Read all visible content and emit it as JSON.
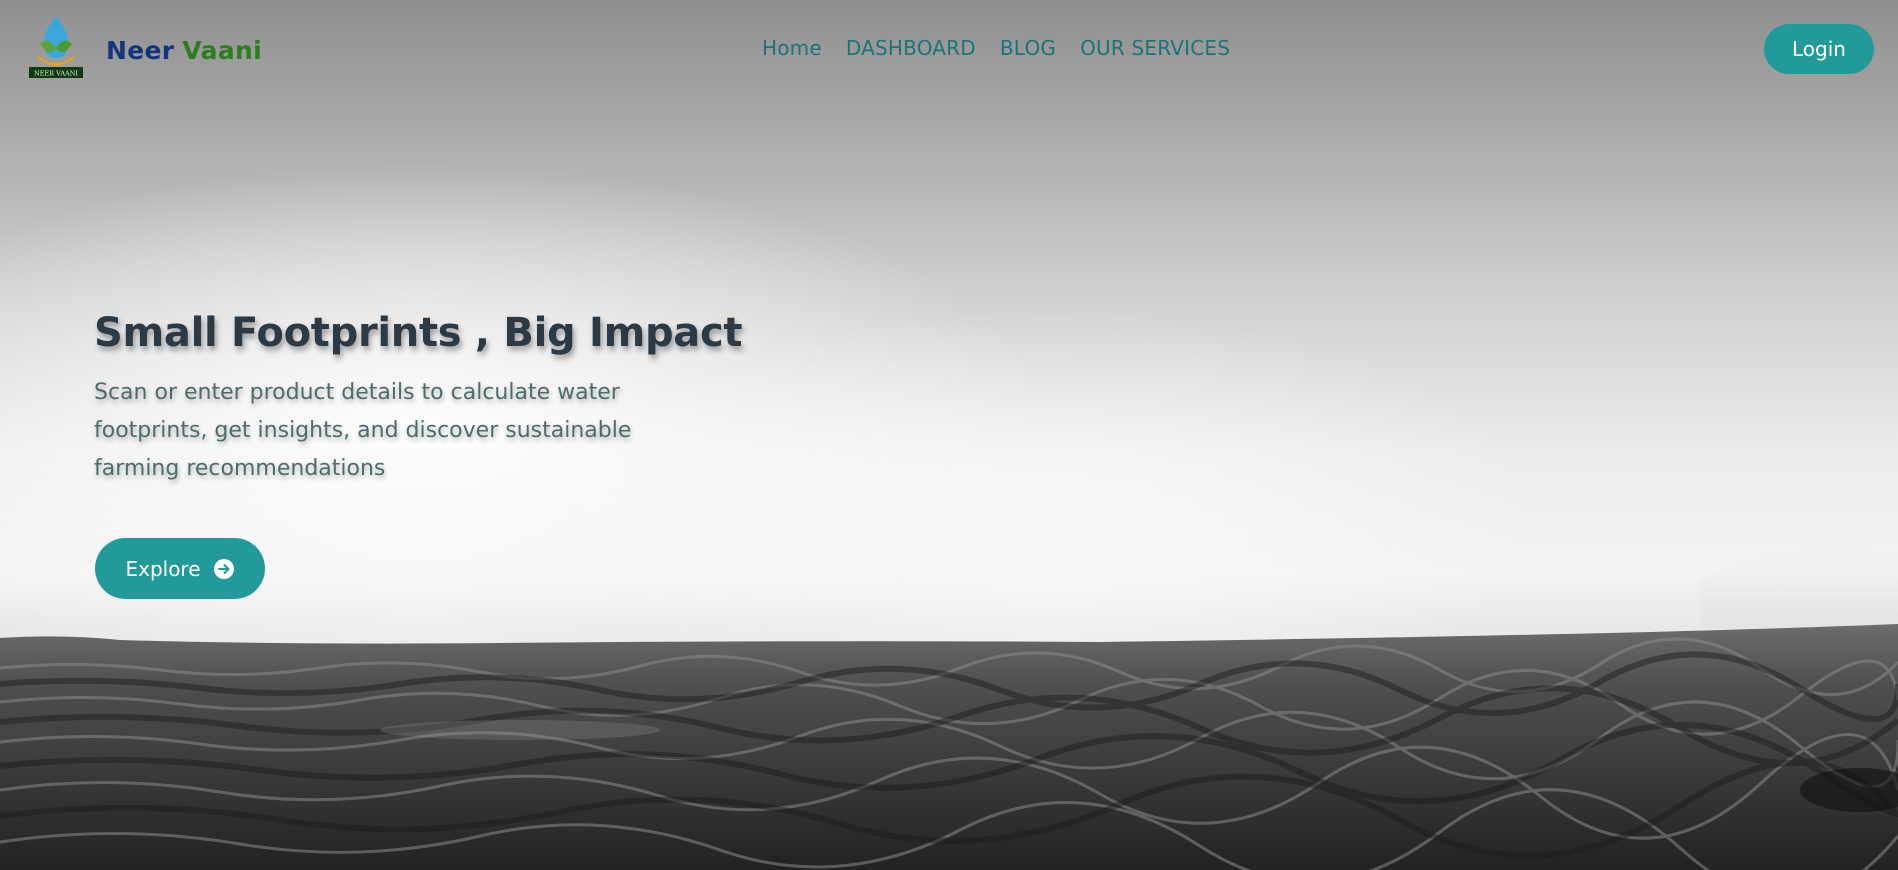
{
  "brand": {
    "name_part1": "Neer",
    "name_part2": "Vaani",
    "logo_caption": "NEER VAANI",
    "logo_icon": "water-drop-leaf-logo"
  },
  "nav": {
    "items": [
      {
        "label": "Home"
      },
      {
        "label": "DASHBOARD"
      },
      {
        "label": "BLOG"
      },
      {
        "label": "OUR SERVICES"
      }
    ],
    "login_label": "Login"
  },
  "hero": {
    "headline": "Small Footprints , Big Impact",
    "subtext": "Scan or enter product details to calculate water footprints, get insights, and discover sustainable farming recommendations",
    "cta_label": "Explore",
    "cta_icon": "arrow-right-circle-icon"
  },
  "colors": {
    "accent": "#239a9a",
    "nav_link": "#1d7474",
    "brand_blue": "#14357d",
    "brand_green": "#2b7d1d",
    "headline": "#2b3a45"
  }
}
